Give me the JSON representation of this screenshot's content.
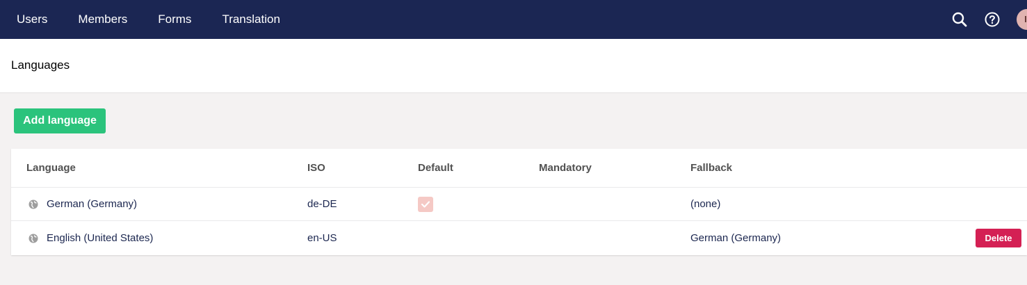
{
  "nav": {
    "items": [
      {
        "label": "Users"
      },
      {
        "label": "Members"
      },
      {
        "label": "Forms"
      },
      {
        "label": "Translation"
      }
    ],
    "icons": [
      "search-icon",
      "help-icon",
      "avatar"
    ]
  },
  "page": {
    "title": "Languages",
    "add_button": "Add language"
  },
  "table": {
    "headers": {
      "language": "Language",
      "iso": "ISO",
      "default": "Default",
      "mandatory": "Mandatory",
      "fallback": "Fallback"
    },
    "rows": [
      {
        "language": "German (Germany)",
        "iso": "de-DE",
        "default": true,
        "mandatory": false,
        "fallback": "(none)"
      },
      {
        "language": "English (United States)",
        "iso": "en-US",
        "default": false,
        "mandatory": false,
        "fallback": "German (Germany)",
        "action": "Delete"
      }
    ]
  },
  "colors": {
    "topbar": "#1b2653",
    "add_button": "#2bc37c",
    "delete_button": "#d42054",
    "default_check": "#f5c9c5"
  }
}
